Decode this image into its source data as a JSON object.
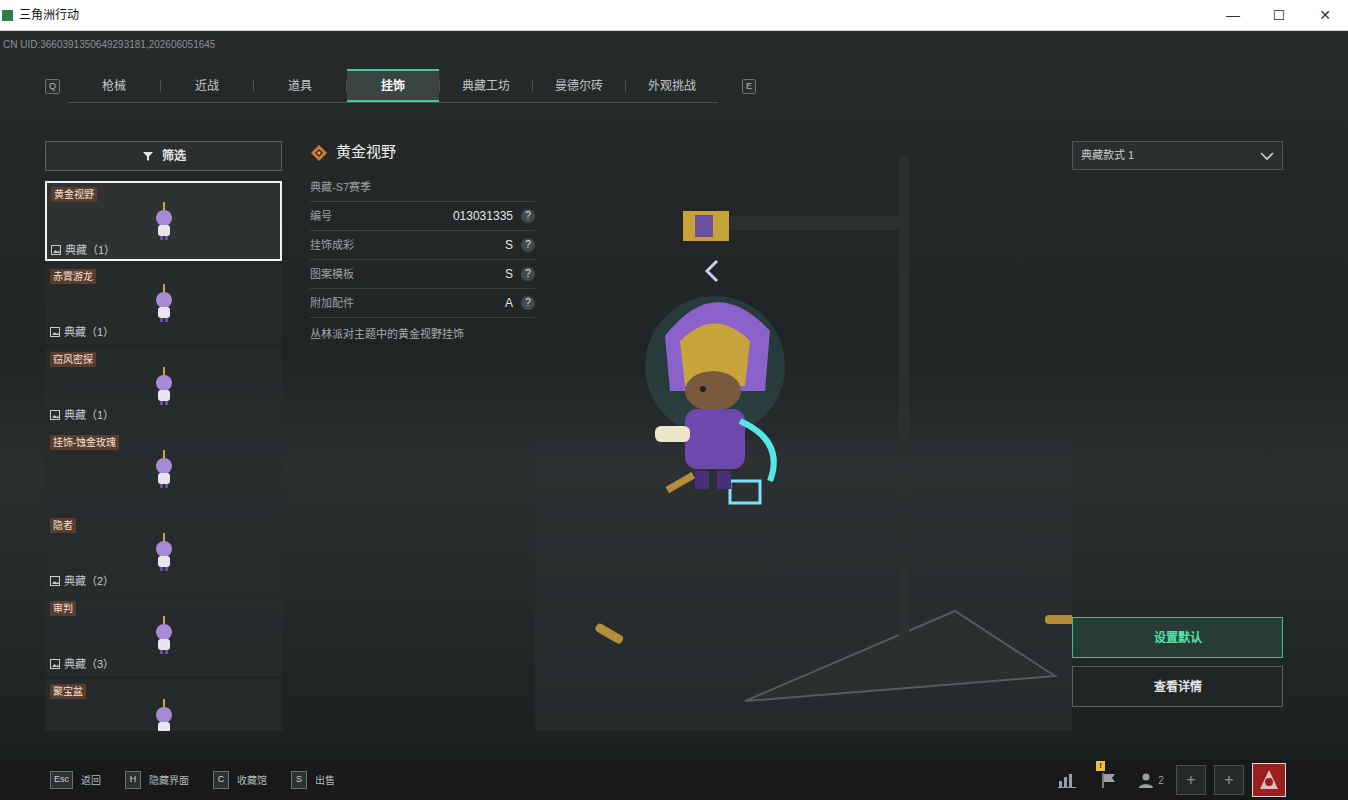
{
  "window": {
    "title": "三角洲行动",
    "controls": [
      "—",
      "☐",
      "✕"
    ]
  },
  "uid": "CN UID:3660391350649293181,202606051645",
  "tabs": {
    "prev_key": "Q",
    "next_key": "E",
    "items": [
      {
        "label": "枪械",
        "selected": false
      },
      {
        "label": "近战",
        "selected": false
      },
      {
        "label": "道具",
        "selected": false
      },
      {
        "label": "挂饰",
        "selected": true
      },
      {
        "label": "典藏工坊",
        "selected": false
      },
      {
        "label": "曼德尔砖",
        "selected": false
      },
      {
        "label": "外观挑战",
        "selected": false
      }
    ]
  },
  "filter": {
    "label": "筛选"
  },
  "items": [
    {
      "name": "黄金视野",
      "tag": "典藏（1）",
      "selected": true
    },
    {
      "name": "赤霄游龙",
      "tag": "典藏（1）",
      "selected": false
    },
    {
      "name": "窃风密探",
      "tag": "典藏（1）",
      "selected": false
    },
    {
      "name": "挂饰-蚀金玫瑰",
      "selected": false
    },
    {
      "name": "隐者",
      "tag": "典藏（2）",
      "selected": false
    },
    {
      "name": "审判",
      "tag": "典藏（3）",
      "selected": false
    },
    {
      "name": "聚宝盆",
      "selected": false
    }
  ],
  "detail": {
    "title": "黄金视野",
    "season": "典藏-S7赛季",
    "attributes": [
      {
        "label": "编号",
        "value": "013031335",
        "help": "?"
      },
      {
        "label": "挂饰成彩",
        "value": "S",
        "help": "?"
      },
      {
        "label": "图案模板",
        "value": "S",
        "help": "?"
      },
      {
        "label": "附加配件",
        "value": "A",
        "help": "?"
      }
    ],
    "description": "丛林派对主题中的黄金视野挂饰"
  },
  "style_select": {
    "value": "典藏款式 1"
  },
  "buttons": [
    {
      "label": "设置默认",
      "primary": true
    },
    {
      "label": "查看详情",
      "primary": false
    }
  ],
  "hotkeys": [
    {
      "key": "Esc",
      "label": "返回"
    },
    {
      "key": "H",
      "label": "隐藏界面"
    },
    {
      "key": "C",
      "label": "收藏馆"
    },
    {
      "key": "S",
      "label": "出售"
    }
  ],
  "tray": {
    "alert": "!",
    "party_count": "2",
    "add_slots": [
      "+",
      "+"
    ]
  }
}
